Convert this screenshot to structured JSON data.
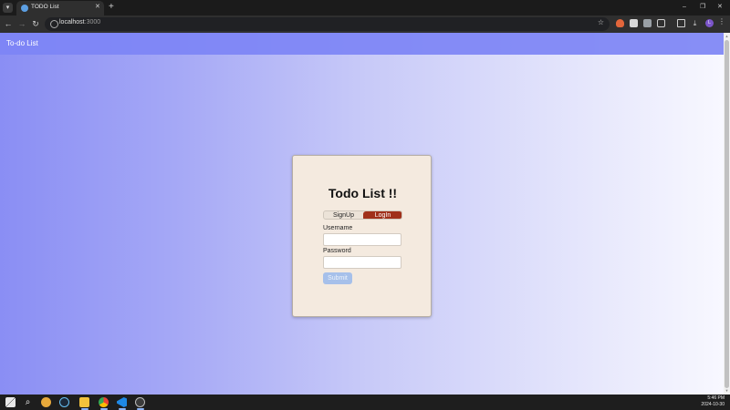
{
  "browser": {
    "tab_title": "TODO List",
    "url_host": "localhost",
    "url_port": ":3000",
    "icons": [
      "tab-menu-icon",
      "favicon-icon",
      "close-icon",
      "plus-icon",
      "back-icon",
      "forward-icon",
      "reload-icon",
      "info-icon",
      "star-icon",
      "extension-icon",
      "profile-icon",
      "more-icon"
    ]
  },
  "window_controls": {
    "minimize": "–",
    "restore": "❐",
    "close": "✕"
  },
  "profile_initial": "L",
  "app": {
    "brand": "To-do List"
  },
  "auth_card": {
    "title": "Todo List !!",
    "toggle": {
      "signup_label": "SignUp",
      "login_label": "LogIn",
      "active": "login"
    },
    "username_label": "Username",
    "username_value": "",
    "password_label": "Password",
    "password_value": "",
    "submit_label": "Submit"
  },
  "taskbar": {
    "time": "5:46 PM",
    "date": "2024-10-30",
    "icons": [
      "windows-start-icon",
      "search-icon",
      "chrome-canary-icon",
      "steam-icon",
      "file-explorer-icon",
      "chrome-icon",
      "vscode-icon",
      "app-icon"
    ]
  },
  "colors": {
    "header": "#7d84f5",
    "gradient_start": "#8a8ef4",
    "gradient_end": "#f8f8ff",
    "card_bg": "#f4eadf",
    "login_active": "#a0301a",
    "submit_bg": "#a6c0ea"
  }
}
